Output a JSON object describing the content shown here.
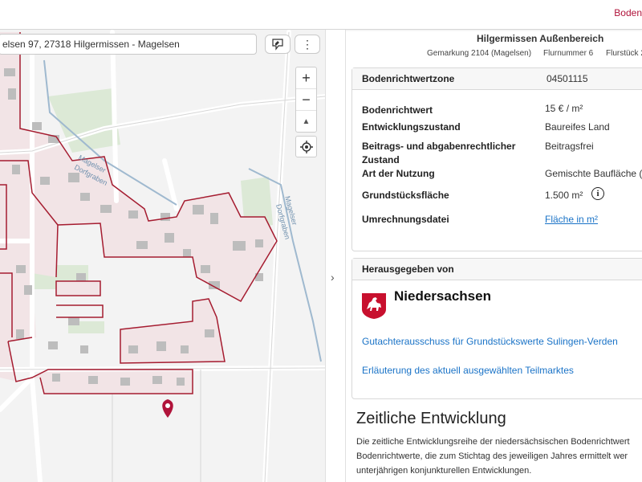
{
  "topbar": {
    "right_link": "Boden"
  },
  "search": {
    "value": "elsen 97, 27318 Hilgermissen - Magelsen"
  },
  "map": {
    "zoom_in": "+",
    "zoom_out": "−",
    "compass": "▲",
    "more": "⋮",
    "labels": {
      "stream1_a": "Magelser",
      "stream1_b": "Dorfgraben",
      "stream2_a": "Magelser",
      "stream2_b": "Dorfgraben"
    }
  },
  "divider": {
    "chevron": "›"
  },
  "header": {
    "title": "Hilgermissen Außenbereich",
    "gemarkung": "Gemarkung 2104 (Magelsen)",
    "flurnummer": "Flurnummer 6",
    "flurstueck": "Flurstück 2"
  },
  "card1": {
    "head_label": "Bodenrichtwertzone",
    "head_value": "04501115",
    "rows": [
      {
        "label": "Bodenrichtwert",
        "value": "15 € / m²"
      },
      {
        "label": "Entwicklungszustand",
        "value": "Baureifes Land"
      },
      {
        "label": "Beitrags- und abgabenrechtlicher Zustand",
        "value": "Beitragsfrei"
      },
      {
        "label": "Art der Nutzung",
        "value": "Gemischte Baufläche (A"
      },
      {
        "label": "Grundstücksfläche",
        "value": "1.500 m²"
      },
      {
        "label": "Umrechnungsdatei",
        "value": "Fläche in m²"
      }
    ],
    "info_glyph": "i"
  },
  "card2": {
    "head_label": "Herausgegeben von",
    "publisher": "Niedersachsen",
    "link1": "Gutachterausschuss für Grundstückswerte Sulingen-Verden",
    "link2": "Erläuterung des aktuell ausgewählten Teilmarktes"
  },
  "section": {
    "title": "Zeitliche Entwicklung",
    "lines": [
      "Die zeitliche Entwicklungsreihe der niedersächsischen Bodenrichtwert",
      "Bodenrichtwerte, die zum Stichtag des jeweiligen Jahres ermittelt wer",
      "unterjährigen konjunkturellen Entwicklungen."
    ]
  },
  "colors": {
    "accent": "#b0133a",
    "zone_border": "#a51c30",
    "link": "#1a73c7"
  }
}
